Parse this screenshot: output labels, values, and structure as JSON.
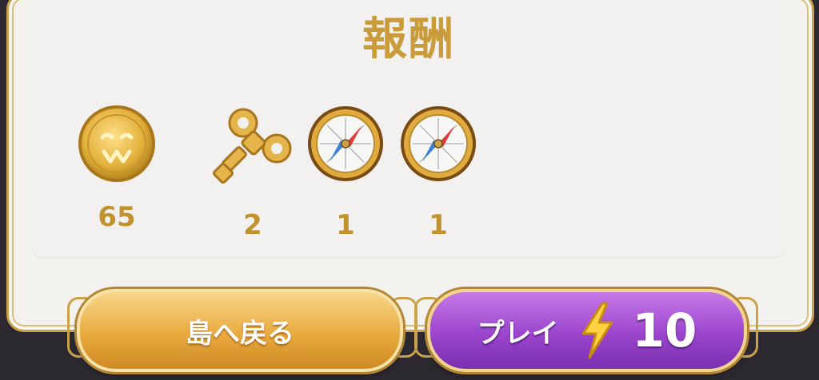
{
  "title": "報酬",
  "rewards": [
    {
      "icon": "coin-icon",
      "count": "65"
    },
    {
      "icon": "windup-key-icon",
      "count": "2"
    },
    {
      "icon": "compass-icon",
      "count": "1"
    },
    {
      "icon": "compass-icon",
      "count": "1"
    }
  ],
  "buttons": {
    "back_label": "島へ戻る",
    "play_label": "プレイ",
    "play_cost": "10",
    "play_cost_icon": "lightning-icon"
  },
  "colors": {
    "title_gold": "#c99b3b",
    "back_button": "#e9aa3f",
    "play_button": "#9a45cc"
  }
}
